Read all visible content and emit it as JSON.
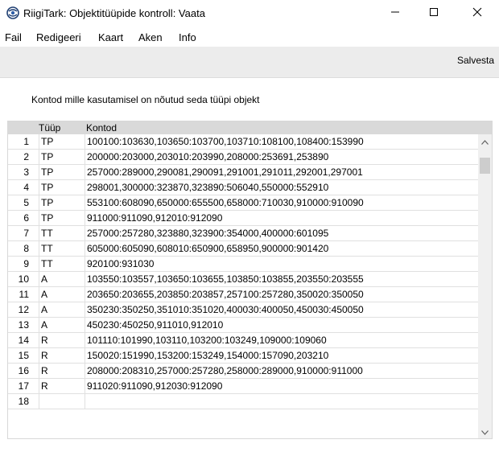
{
  "window": {
    "title": "RiigiTark: Objektitüüpide kontroll: Vaata"
  },
  "menu": {
    "items": [
      "Fail",
      "Redigeeri",
      "Kaart",
      "Aken",
      "Info"
    ]
  },
  "toolbar": {
    "save_label": "Salvesta"
  },
  "section": {
    "label": "Kontod mille kasutamisel on nõutud seda tüüpi objekt"
  },
  "table": {
    "headers": {
      "num": "",
      "type": "Tüüp",
      "accounts": "Kontod"
    },
    "rows": [
      {
        "num": "1",
        "type": "TP",
        "accounts": "100100:103630,103650:103700,103710:108100,108400:153990"
      },
      {
        "num": "2",
        "type": "TP",
        "accounts": "200000:203000,203010:203990,208000:253691,253890"
      },
      {
        "num": "3",
        "type": "TP",
        "accounts": "257000:289000,290081,290091,291001,291011,292001,297001"
      },
      {
        "num": "4",
        "type": "TP",
        "accounts": "298001,300000:323870,323890:506040,550000:552910"
      },
      {
        "num": "5",
        "type": "TP",
        "accounts": "553100:608090,650000:655500,658000:710030,910000:910090"
      },
      {
        "num": "6",
        "type": "TP",
        "accounts": "911000:911090,912010:912090"
      },
      {
        "num": "7",
        "type": "TT",
        "accounts": "257000:257280,323880,323900:354000,400000:601095"
      },
      {
        "num": "8",
        "type": "TT",
        "accounts": "605000:605090,608010:650900,658950,900000:901420"
      },
      {
        "num": "9",
        "type": "TT",
        "accounts": "920100:931030"
      },
      {
        "num": "10",
        "type": "A",
        "accounts": "103550:103557,103650:103655,103850:103855,203550:203555"
      },
      {
        "num": "11",
        "type": "A",
        "accounts": "203650:203655,203850:203857,257100:257280,350020:350050"
      },
      {
        "num": "12",
        "type": "A",
        "accounts": "350230:350250,351010:351020,400030:400050,450030:450050"
      },
      {
        "num": "13",
        "type": "A",
        "accounts": "450230:450250,911010,912010"
      },
      {
        "num": "14",
        "type": "R",
        "accounts": "101110:101990,103110,103200:103249,109000:109060"
      },
      {
        "num": "15",
        "type": "R",
        "accounts": "150020:151990,153200:153249,154000:157090,203210"
      },
      {
        "num": "16",
        "type": "R",
        "accounts": "208000:208310,257000:257280,258000:289000,910000:911000"
      },
      {
        "num": "17",
        "type": "R",
        "accounts": "911020:911090,912030:912090"
      },
      {
        "num": "18",
        "type": "",
        "accounts": ""
      }
    ]
  },
  "icons": {
    "app": "app-globe-icon",
    "minimize": "minimize-icon",
    "maximize": "maximize-icon",
    "close": "close-icon",
    "scroll_up": "chevron-up-icon",
    "scroll_down": "chevron-down-icon"
  },
  "colors": {
    "toolbar_bg": "#ececec",
    "header_bg": "#d9d9d9",
    "grid_line": "#e0e0e0",
    "scrollbar_thumb": "#cdcdcd"
  }
}
